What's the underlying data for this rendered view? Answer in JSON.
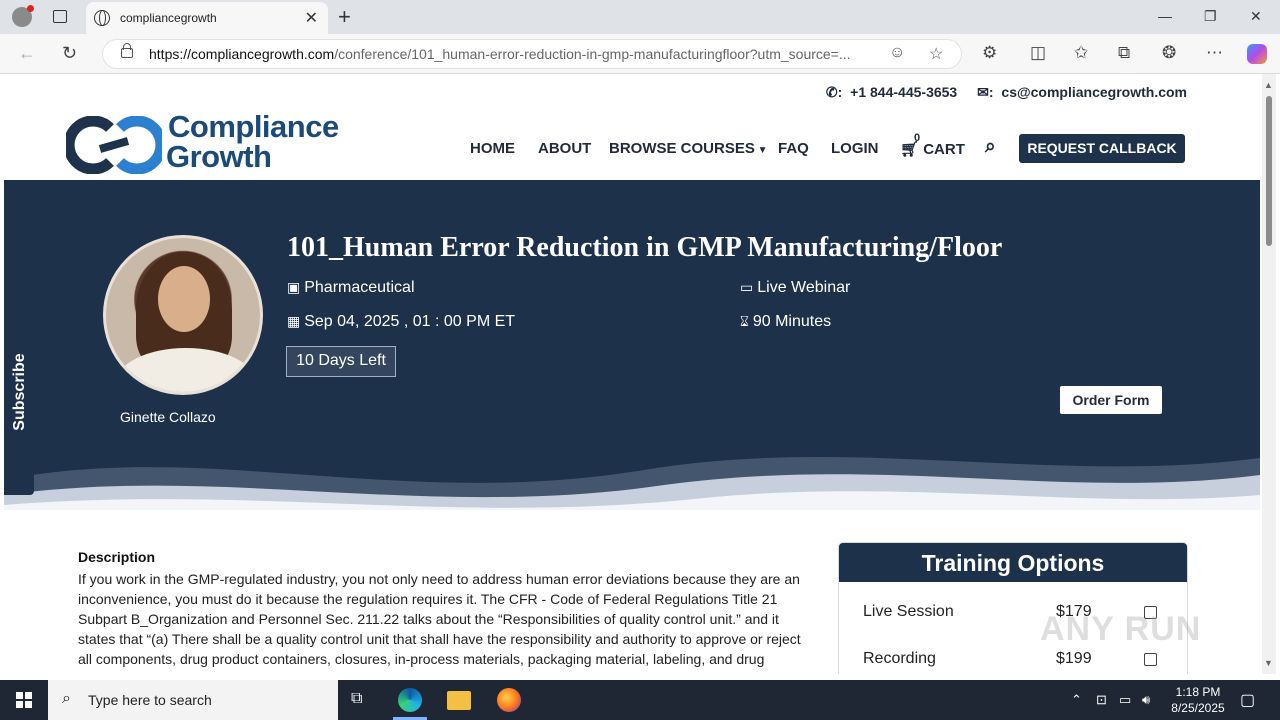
{
  "browser": {
    "tab_title": "compliancegrowth",
    "url_domain": "https://compliancegrowth.com",
    "url_path": "/conference/101_human-error-reduction-in-gmp-manufacturingfloor?utm_source=..."
  },
  "topbar": {
    "phone": "+1 844-445-3653",
    "email": "cs@compliancegrowth.com"
  },
  "logo": {
    "line1": "Compliance",
    "line2": "Growth"
  },
  "nav": {
    "home": "HOME",
    "about": "ABOUT",
    "browse": "BROWSE COURSES",
    "faq": "FAQ",
    "login": "LOGIN",
    "cart": "CART",
    "cart_count": "0",
    "callback": "REQUEST CALLBACK"
  },
  "hero": {
    "title": "101_Human Error Reduction in GMP Manufacturing/Floor",
    "industry": "Pharmaceutical",
    "format": "Live Webinar",
    "date": "Sep 04, 2025 , 01 : 00 PM ET",
    "duration": "90 Minutes",
    "days_left": "10 Days Left",
    "speaker": "Ginette Collazo",
    "order_button": "Order Form"
  },
  "subscribe": "Subscribe",
  "description": {
    "title": "Description",
    "text": "If you work in the GMP-regulated industry, you not only need to address human error deviations because they are an inconvenience, you must do it because the regulation requires it. The CFR - Code of Federal Regulations Title 21 Subpart B_Organization and Personnel Sec. 211.22 talks about the “Responsibilities of quality control unit.” and it states that “(a) There shall be a quality control unit that shall have the responsibility and authority to approve or reject all components, drug product containers, closures, in-process materials, packaging material, labeling, and drug products, and the authority to review production records to assure that no errors have"
  },
  "training": {
    "title": "Training Options",
    "options": [
      {
        "label": "Live Session",
        "price": "$179"
      },
      {
        "label": "Recording",
        "price": "$199"
      }
    ]
  },
  "watermark": "ANY RUN",
  "taskbar": {
    "search_placeholder": "Type here to search",
    "time": "1:18 PM",
    "date": "8/25/2025"
  },
  "colors": {
    "navy": "#1d314b",
    "brand_blue": "#1c4b7a"
  }
}
